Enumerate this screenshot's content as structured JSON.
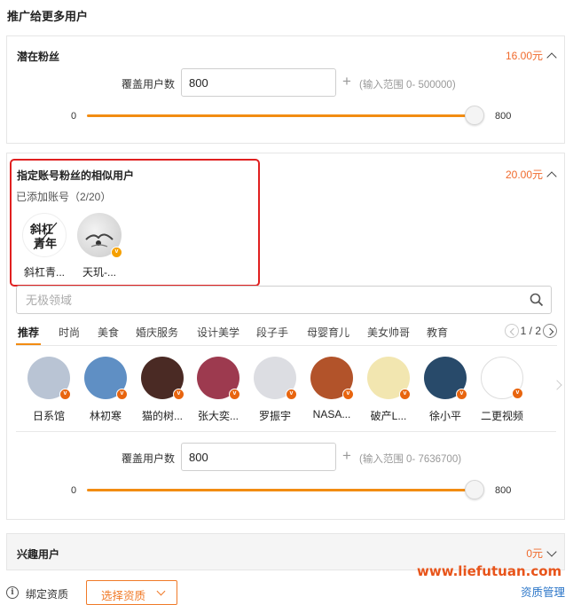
{
  "page_title": "推广给更多用户",
  "potential_fans": {
    "title": "潜在粉丝",
    "price": "16.00元",
    "cover_label": "覆盖用户数",
    "cover_value": "800",
    "plus": "+",
    "range_hint": "(输入范围 0- 500000)",
    "slider_min": "0",
    "slider_max": "800",
    "slider_level": 1.0
  },
  "similar_users": {
    "title": "指定账号粉丝的相似用户",
    "price": "20.00元",
    "added_label": "已添加账号（2/20）",
    "added_accounts": [
      {
        "name": "斜杠青...",
        "logo_text": "斜杠青年"
      },
      {
        "name": "天玑-..."
      }
    ],
    "search_placeholder": "无极领域",
    "tabs": [
      "推荐",
      "时尚",
      "美食",
      "婚庆服务",
      "设计美学",
      "段子手",
      "母婴育儿",
      "美女帅哥",
      "教育"
    ],
    "pager": "1 / 2",
    "recommended": [
      {
        "name": "日系馆",
        "badge": "v",
        "color": "#b9c4d4"
      },
      {
        "name": "林初寒",
        "badge": "v",
        "color": "#5f8fc4"
      },
      {
        "name": "猫的树...",
        "badge": "v",
        "color": "#4a2a24"
      },
      {
        "name": "张大奕...",
        "badge": "v",
        "color": "#9d3a4f"
      },
      {
        "name": "罗振宇",
        "badge": "v",
        "color": "#dcdde2"
      },
      {
        "name": "NASA...",
        "badge": "v",
        "color": "#b2532a"
      },
      {
        "name": "破产L...",
        "badge": "v",
        "color": "#f2e6b0"
      },
      {
        "name": "徐小平",
        "badge": "v",
        "color": "#284a6a"
      },
      {
        "name": "二更视频",
        "badge": "v",
        "color": "#ffffff"
      }
    ],
    "cover_label": "覆盖用户数",
    "cover_value": "800",
    "plus": "+",
    "range_hint": "(输入范围 0- 7636700)",
    "slider_min": "0",
    "slider_max": "800",
    "slider_level": 1.0
  },
  "interest_users": {
    "title": "兴趣用户",
    "price": "0元"
  },
  "bottom": {
    "info_icon": "i",
    "bind_label": "绑定资质",
    "select_button": "选择资质",
    "manage_link": "资质管理"
  },
  "watermark": "www.liefutuan.com"
}
